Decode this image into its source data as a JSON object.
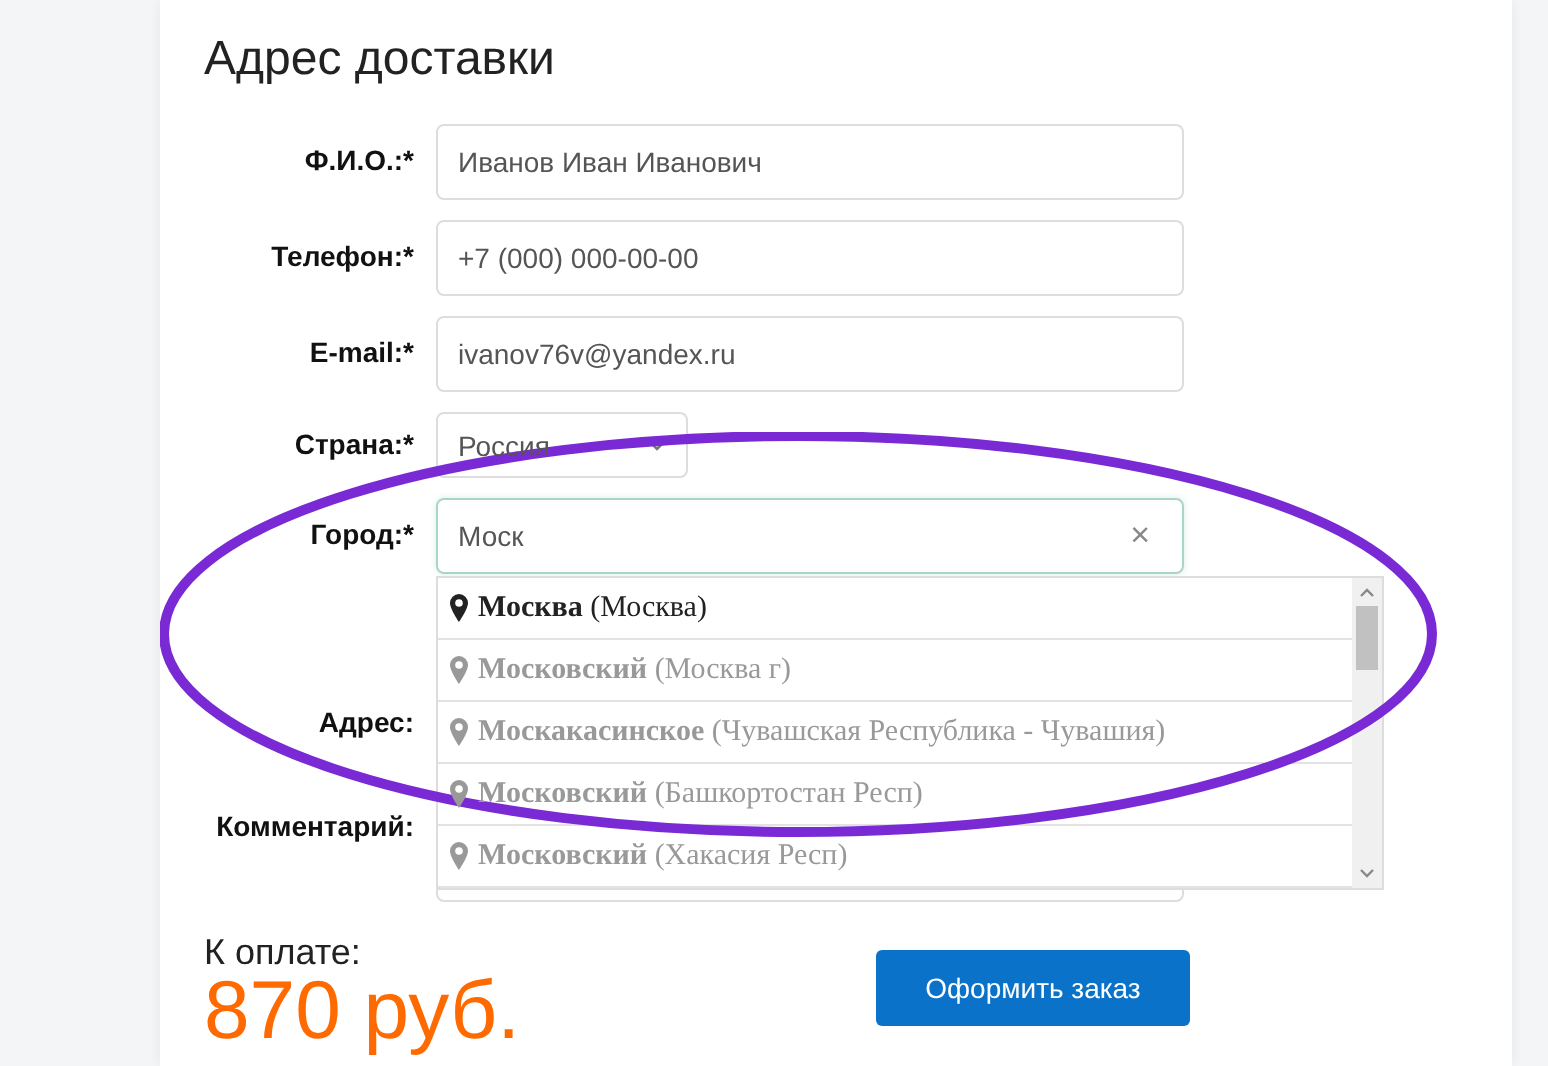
{
  "title": "Адрес доставки",
  "fields": [
    {
      "kind": "input",
      "label": "Ф.И.О.:*",
      "value": "Иванов Иван Иванович"
    },
    {
      "kind": "input",
      "label": "Телефон:*",
      "value": "+7 (000) 000-00-00"
    },
    {
      "kind": "input",
      "label": "E-mail:*",
      "value": "ivanov76v@yandex.ru"
    },
    {
      "kind": "select",
      "label": "Страна:*",
      "value": "Россия"
    },
    {
      "kind": "search",
      "label": "Город:*",
      "value": "Моск",
      "clear": "×"
    },
    {
      "kind": "address",
      "label": "Адрес:"
    },
    {
      "kind": "textarea",
      "label": "Комментарий:"
    }
  ],
  "suggestions": [
    {
      "text": "**Москва** (Москва)",
      "selected": true
    },
    {
      "text": "**Московский** (Москва г)",
      "selected": false
    },
    {
      "text": "**Москакасинское** (Чувашская Республика - Чувашия)",
      "selected": false
    },
    {
      "text": "**Московский** (Башкортостан Респ)",
      "selected": false
    },
    {
      "text": "**Московский** (Хакасия Респ)",
      "selected": false
    }
  ],
  "payment": {
    "label": "К оплате:",
    "amount": "870 руб."
  },
  "submit": "Оформить заказ"
}
